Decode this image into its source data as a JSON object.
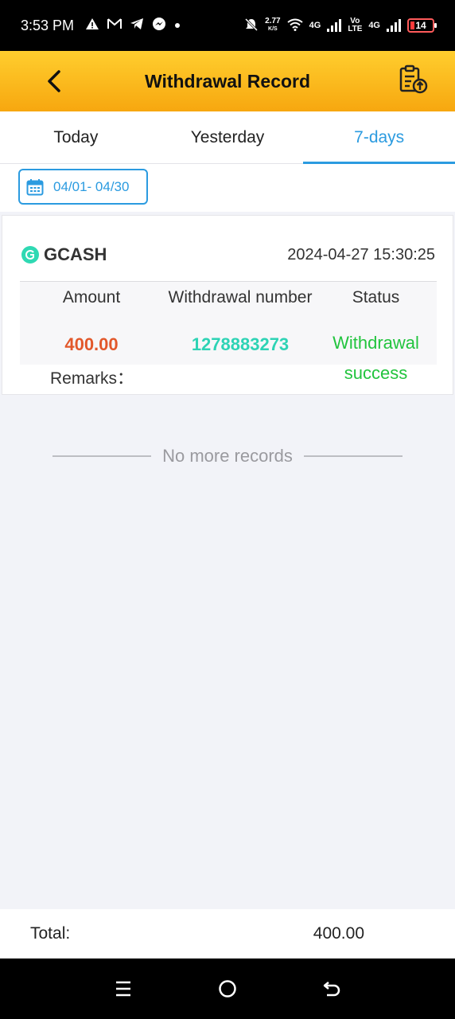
{
  "status_bar": {
    "time": "3:53 PM",
    "net_speed": "2.77",
    "net_unit": "K/S",
    "net_type_1": "4G",
    "volte": "Vo LTE",
    "net_type_2": "4G",
    "battery": "14",
    "icons": [
      "warning-icon",
      "gmail-icon",
      "telegram-icon",
      "messenger-icon",
      "dot-icon",
      "mute-bell-icon",
      "wifi-icon",
      "signal-icon",
      "battery-icon"
    ]
  },
  "header": {
    "title": "Withdrawal Record",
    "back_icon": "chevron-left-icon",
    "export_icon": "clipboard-upload-icon"
  },
  "tabs": [
    {
      "label": "Today",
      "active": false
    },
    {
      "label": "Yesterday",
      "active": false
    },
    {
      "label": "7-days",
      "active": true
    }
  ],
  "filter": {
    "date_range": "04/01- 04/30",
    "icon": "calendar-icon"
  },
  "record": {
    "method": "GCASH",
    "datetime": "2024-04-27 15:30:25",
    "amount_label": "Amount",
    "number_label": "Withdrawal number",
    "status_label": "Status",
    "amount": "400.00",
    "number": "1278883273",
    "status_line1": "Withdrawal",
    "status_line2": "success",
    "remarks_label": "Remarks："
  },
  "list_end": "No more records",
  "footer": {
    "total_label": "Total:",
    "total_value": "400.00"
  },
  "navbar": {
    "icons": [
      "menu-icon",
      "home-icon",
      "back-icon"
    ]
  },
  "colors": {
    "header_top": "#ffce2e",
    "header_bottom": "#f7a70f",
    "accent": "#2b9be0",
    "amount": "#e2582b",
    "number": "#2ed3b5",
    "success": "#22c43e"
  }
}
